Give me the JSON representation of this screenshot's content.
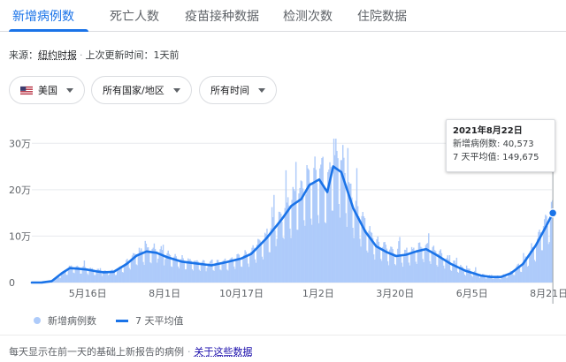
{
  "tabs": [
    {
      "label": "新增病例数",
      "active": true
    },
    {
      "label": "死亡人数",
      "active": false
    },
    {
      "label": "疫苗接种数据",
      "active": false
    },
    {
      "label": "检测次数",
      "active": false
    },
    {
      "label": "住院数据",
      "active": false
    }
  ],
  "source": {
    "prefix": "来源：",
    "name": "纽约时报",
    "updated": "上次更新时间：1天前"
  },
  "filters": {
    "country": "美国",
    "region": "所有国家/地区",
    "time": "所有时间"
  },
  "tooltip": {
    "date": "2021年8月22日",
    "cases_label": "新增病例数:",
    "cases_value": "40,573",
    "avg_label": "7 天平均值:",
    "avg_value": "149,675"
  },
  "legend": {
    "daily": "新增病例数",
    "avg": "7 天平均值"
  },
  "footer": {
    "note": "每天显示在前一天的基础上新报告的病例",
    "link": "关于这些数据"
  },
  "colors": {
    "accent": "#1a73e8",
    "bars": "#aecbfa",
    "grid": "#e8eaed"
  },
  "chart_data": {
    "type": "area",
    "y_tick_labels": [
      "0",
      "10万",
      "20万",
      "30万"
    ],
    "y_ticks": [
      0,
      100000,
      200000,
      300000
    ],
    "ylim": [
      0,
      310000
    ],
    "x_tick_labels": [
      "5月16日",
      "8月1日",
      "10月17日",
      "1月2日",
      "3月20日",
      "6月5日",
      "8月21日"
    ],
    "x_ticks_day": [
      56,
      133,
      210,
      287,
      364,
      441,
      518
    ],
    "xlim_day": [
      0,
      521
    ],
    "series": [
      {
        "name": "7 天平均值",
        "points": [
          [
            0,
            0
          ],
          [
            10,
            200
          ],
          [
            20,
            3000
          ],
          [
            30,
            20000
          ],
          [
            38,
            31000
          ],
          [
            45,
            30000
          ],
          [
            55,
            28000
          ],
          [
            65,
            24000
          ],
          [
            72,
            22000
          ],
          [
            82,
            23000
          ],
          [
            95,
            40000
          ],
          [
            105,
            58000
          ],
          [
            115,
            67000
          ],
          [
            125,
            64000
          ],
          [
            135,
            55000
          ],
          [
            150,
            45000
          ],
          [
            165,
            41000
          ],
          [
            180,
            37000
          ],
          [
            195,
            44000
          ],
          [
            210,
            52000
          ],
          [
            220,
            62000
          ],
          [
            235,
            95000
          ],
          [
            250,
            135000
          ],
          [
            260,
            165000
          ],
          [
            270,
            180000
          ],
          [
            278,
            210000
          ],
          [
            288,
            222000
          ],
          [
            296,
            195000
          ],
          [
            302,
            250000
          ],
          [
            310,
            238000
          ],
          [
            322,
            160000
          ],
          [
            334,
            110000
          ],
          [
            345,
            78000
          ],
          [
            355,
            66000
          ],
          [
            365,
            57000
          ],
          [
            375,
            60000
          ],
          [
            385,
            67000
          ],
          [
            395,
            72000
          ],
          [
            405,
            60000
          ],
          [
            420,
            40000
          ],
          [
            435,
            25000
          ],
          [
            450,
            15000
          ],
          [
            460,
            12000
          ],
          [
            470,
            12000
          ],
          [
            480,
            20000
          ],
          [
            492,
            40000
          ],
          [
            505,
            80000
          ],
          [
            515,
            120000
          ],
          [
            522,
            149675
          ]
        ]
      },
      {
        "name": "新增病例数",
        "style": "daily bars around the 7-day average with weekly variation",
        "highlight": {
          "date": "2021年8月22日",
          "value": 40573
        }
      }
    ]
  }
}
